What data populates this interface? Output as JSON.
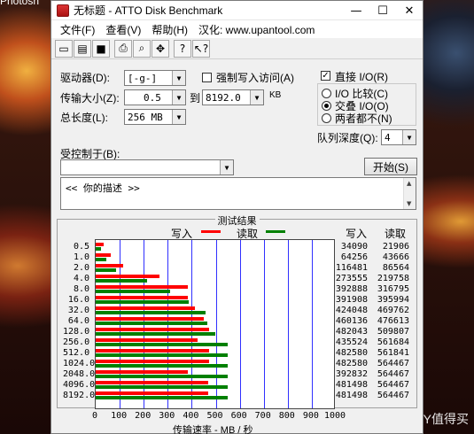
{
  "desktop": {
    "corner_text": "Photosh",
    "watermark": "SMY值得买"
  },
  "window": {
    "title": "无标题 - ATTO Disk Benchmark",
    "controls": {
      "minimize": "—",
      "maximize": "☐",
      "close": "✕"
    },
    "menu": [
      "文件(F)",
      "查看(V)",
      "帮助(H)",
      "汉化: www.upantool.com"
    ],
    "toolbar": [
      {
        "icon": "new-file-icon",
        "glyph": "▭"
      },
      {
        "icon": "open-folder-icon",
        "glyph": "▤"
      },
      {
        "icon": "save-icon",
        "glyph": "■"
      },
      {
        "icon": "print-icon",
        "glyph": "⎙"
      },
      {
        "icon": "print-preview-icon",
        "glyph": "⌕"
      },
      {
        "icon": "move-icon",
        "glyph": "✥"
      },
      {
        "icon": "help-icon",
        "glyph": "?"
      },
      {
        "icon": "context-help-icon",
        "glyph": "↖?"
      }
    ]
  },
  "form": {
    "drive_label": "驱动器(D):",
    "drive_value": "[-g-]",
    "force_write_label": "强制写入访问(A)",
    "transfer_label": "传输大小(Z):",
    "transfer_from": "0.5",
    "to_label": "到",
    "transfer_to": "8192.0",
    "kb_label": "KB",
    "length_label": "总长度(L):",
    "length_value": "256 MB",
    "direct_io_label": "直接 I/O(R)",
    "direct_io_checked": true,
    "io_compare_label": "I/O 比较(C)",
    "overlap_io_label": "交叠 I/O(O)",
    "neither_label": "两者都不(N)",
    "selected_mode": "overlap",
    "queue_label": "队列深度(Q):",
    "queue_value": "4",
    "controlled_by_label": "受控制于(B):",
    "controlled_by_value": "",
    "start_button": "开始(S)",
    "description": "<<  你的描述  >>"
  },
  "results": {
    "title": "测试结果",
    "write_legend": "写入",
    "read_legend": "读取",
    "write_col": "写入",
    "read_col": "读取",
    "write_color": "#ff0000",
    "read_color": "#008000",
    "x_axis_label": "传输速率 - MB / 秒",
    "x_ticks": [
      "0",
      "100",
      "200",
      "300",
      "400",
      "500",
      "600",
      "700",
      "800",
      "900",
      "1000"
    ]
  },
  "chart_data": {
    "type": "bar",
    "title": "测试结果",
    "xlabel": "传输速率 - MB / 秒",
    "xlim": [
      0,
      1000
    ],
    "categories": [
      "0.5",
      "1.0",
      "2.0",
      "4.0",
      "8.0",
      "16.0",
      "32.0",
      "64.0",
      "128.0",
      "256.0",
      "512.0",
      "1024.0",
      "2048.0",
      "4096.0",
      "8192.0"
    ],
    "series": [
      {
        "name": "写入",
        "values": [
          34090,
          64256,
          116481,
          273555,
          392888,
          391908,
          424048,
          460136,
          482043,
          435524,
          482580,
          482580,
          392832,
          481498,
          481498
        ]
      },
      {
        "name": "读取",
        "values": [
          21906,
          43666,
          86564,
          219758,
          316795,
          395994,
          469762,
          476613,
          509807,
          561684,
          561841,
          564467,
          564467,
          564467,
          564467
        ]
      }
    ],
    "legend": "top"
  }
}
